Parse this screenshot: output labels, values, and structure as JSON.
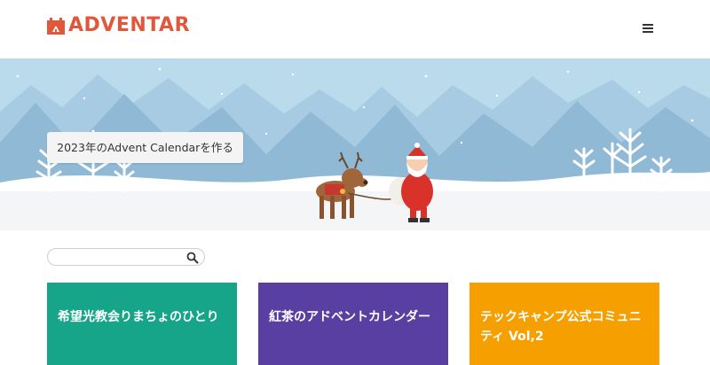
{
  "header": {
    "logo_text": "ADVENTAR",
    "menu_icon": "hamburger-menu-icon"
  },
  "hero": {
    "create_button_label": "2023年のAdvent Calendarを作る"
  },
  "search": {
    "placeholder": "",
    "icon": "search-icon"
  },
  "calendars": [
    {
      "title": "希望光教会りまちょのひとり",
      "color": "#16a589"
    },
    {
      "title": "紅茶のアドベントカレンダー",
      "color": "#5a3fa2"
    },
    {
      "title": "テックキャンプ公式コミュニティ Vol,2",
      "color": "#f5a000"
    }
  ],
  "colors": {
    "brand": "#e0573c",
    "sky": "#b7d9ea",
    "mountain": "#8fb9d5",
    "snow": "#f4f6f8"
  }
}
